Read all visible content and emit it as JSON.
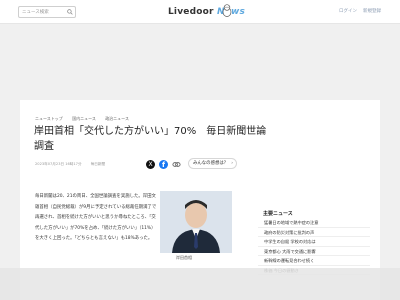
{
  "header": {
    "search_placeholder": "ニュース検索",
    "brand_main": "Livedoor ",
    "brand_news": "News",
    "login": "ログイン",
    "signup": "新規登録"
  },
  "article": {
    "breadcrumbs": [
      "ニューストップ",
      "国内ニュース",
      "政治ニュース"
    ],
    "title": "岸田首相「交代した方がいい」70%　毎日新聞世論調査",
    "date": "2023年07月23日 16時17分",
    "source": "毎日新聞",
    "comments_label": "みんなの感想は？",
    "comments_arrow": "›",
    "body": "毎日新聞は20、21の両日、全国世論調査を実施した。岸田文雄首相（自民党総裁）が9月に予定されている総裁任期満了で再選され、首相を続けた方がいいと思うか尋ねたところ、「交代した方がいい」が70%を占め、「続けた方がいい」（11%）を大きく上回った。「どちらとも言えない」も18%あった。",
    "photo_caption": "岸田首相"
  },
  "share": {
    "x_label": "X",
    "fb_label": "f"
  },
  "sidebar": {
    "title": "主要ニュース",
    "items": [
      "猛暑日の地域で熱中症の注意",
      "政府の防災対策に批判の声",
      "中学生の自殺 学校の対応は",
      "東京都心 大雨で交通に影響",
      "新幹線の運転見合わせ続く",
      "株価 今日の値動き"
    ]
  },
  "colors": {
    "brand_accent": "#5fa9df",
    "fb": "#1877f2"
  }
}
